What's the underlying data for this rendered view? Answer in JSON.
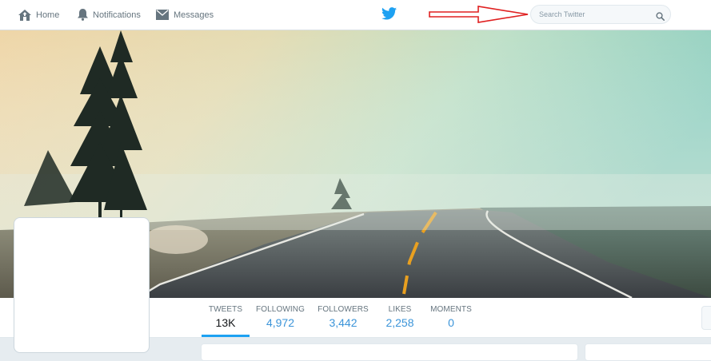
{
  "nav": {
    "home_label": "Home",
    "notifications_label": "Notifications",
    "messages_label": "Messages"
  },
  "search": {
    "placeholder": "Search Twitter",
    "value": ""
  },
  "icons": {
    "home": "home-icon",
    "notifications": "bell-icon",
    "messages": "envelope-icon",
    "logo": "twitter-bird-icon",
    "search": "search-icon",
    "annotation": "red-arrow"
  },
  "colors": {
    "brand": "#1da1f2",
    "link": "#3b94d9",
    "annotation_arrow": "#e02020"
  },
  "profile_nav": {
    "stats": [
      {
        "label": "TWEETS",
        "value": "13K"
      },
      {
        "label": "FOLLOWING",
        "value": "4,972"
      },
      {
        "label": "FOLLOWERS",
        "value": "3,442"
      },
      {
        "label": "LIKES",
        "value": "2,258"
      },
      {
        "label": "MOMENTS",
        "value": "0"
      }
    ]
  }
}
